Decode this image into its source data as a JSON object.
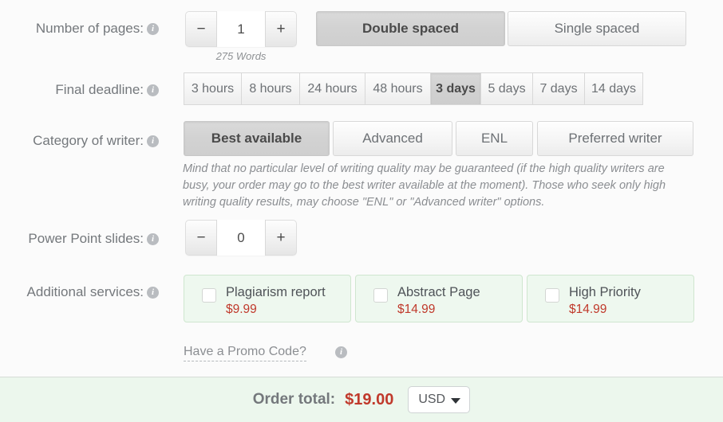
{
  "rows": {
    "pages": {
      "label": "Number of pages:",
      "info_icon": "info-icon",
      "minus": "−",
      "value": "1",
      "plus": "+",
      "words": "275 Words",
      "spacing_options": [
        {
          "label": "Double spaced",
          "selected": true
        },
        {
          "label": "Single spaced",
          "selected": false
        }
      ]
    },
    "deadline": {
      "label": "Final deadline:",
      "info_icon": "info-icon",
      "options": [
        {
          "label": "3 hours",
          "selected": false
        },
        {
          "label": "8 hours",
          "selected": false
        },
        {
          "label": "24 hours",
          "selected": false
        },
        {
          "label": "48 hours",
          "selected": false
        },
        {
          "label": "3 days",
          "selected": true
        },
        {
          "label": "5 days",
          "selected": false
        },
        {
          "label": "7 days",
          "selected": false
        },
        {
          "label": "14 days",
          "selected": false
        }
      ]
    },
    "category": {
      "label": "Category of writer:",
      "info_icon": "info-icon",
      "options": [
        {
          "label": "Best available",
          "selected": true
        },
        {
          "label": "Advanced",
          "selected": false
        },
        {
          "label": "ENL",
          "selected": false
        },
        {
          "label": "Preferred writer",
          "selected": false
        }
      ],
      "note": "Mind that no particular level of writing quality may be guaranteed (if the high quality writers are busy, your order may go to the best writer available at the moment). Those who seek only high writing quality results, may choose \"ENL\" or \"Advanced writer\" options."
    },
    "slides": {
      "label": "Power Point slides:",
      "info_icon": "info-icon",
      "minus": "−",
      "value": "0",
      "plus": "+"
    },
    "services": {
      "label": "Additional services:",
      "info_icon": "info-icon",
      "items": [
        {
          "name": "Plagiarism report",
          "price": "$9.99",
          "checked": false
        },
        {
          "name": "Abstract Page",
          "price": "$14.99",
          "checked": false
        },
        {
          "name": "High Priority",
          "price": "$14.99",
          "checked": false
        }
      ]
    },
    "promo": {
      "label": "Have a Promo Code?",
      "info_icon": "info-icon"
    }
  },
  "footer": {
    "total_label": "Order total:",
    "total_value": "$19.00",
    "currency": "USD",
    "caret_icon": "chevron-down-icon"
  },
  "colors": {
    "page_bg": "#fbfbfb",
    "label_text": "#74787c",
    "price_red": "#c0392b",
    "service_bg": "#eef8ef",
    "service_border": "#cfe6cf",
    "footer_bg": "#ecf7ed",
    "active_btn": "#d4d4d4"
  }
}
